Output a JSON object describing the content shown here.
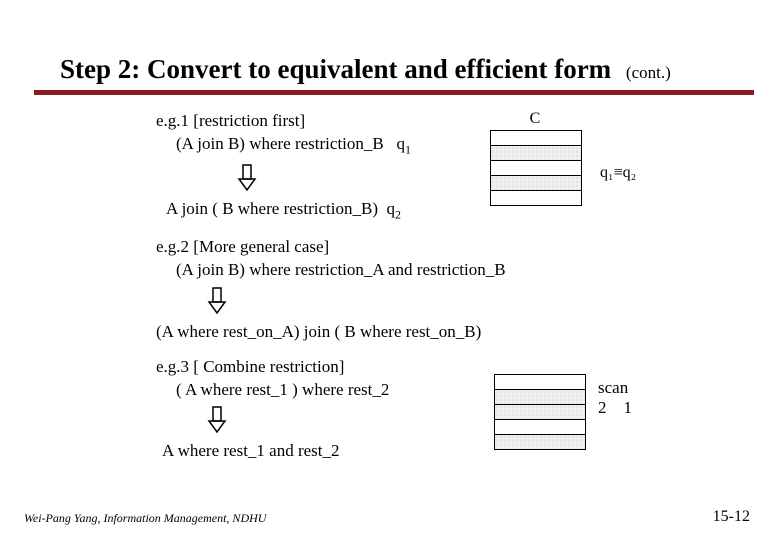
{
  "title": "Step 2: Convert to equivalent and efficient form",
  "cont": "(cont.)",
  "eg1": {
    "head": "e.g.1 [restriction first]",
    "line1a": "(A join B)  where restriction_B",
    "q1": "q",
    "q1sub": "1",
    "line2a": "A join ( B where restriction_B)",
    "q2": "q",
    "q2sub": "2"
  },
  "diagram1": {
    "C": "C",
    "equiv": "q₁≡q₂"
  },
  "eg2": {
    "head": "e.g.2 [More general case]",
    "line1": "(A join B) where restriction_A and restriction_B",
    "line2": "(A where rest_on_A) join ( B where rest_on_B)"
  },
  "eg3": {
    "head": "e.g.3 [ Combine restriction]",
    "line1": "( A where rest_1 ) where rest_2",
    "line2": "A where rest_1 and rest_2"
  },
  "diagram2": {
    "scan": "scan",
    "nums": "2    1"
  },
  "footer": "Wei-Pang Yang, Information Management, NDHU",
  "pagenum": "15-12"
}
